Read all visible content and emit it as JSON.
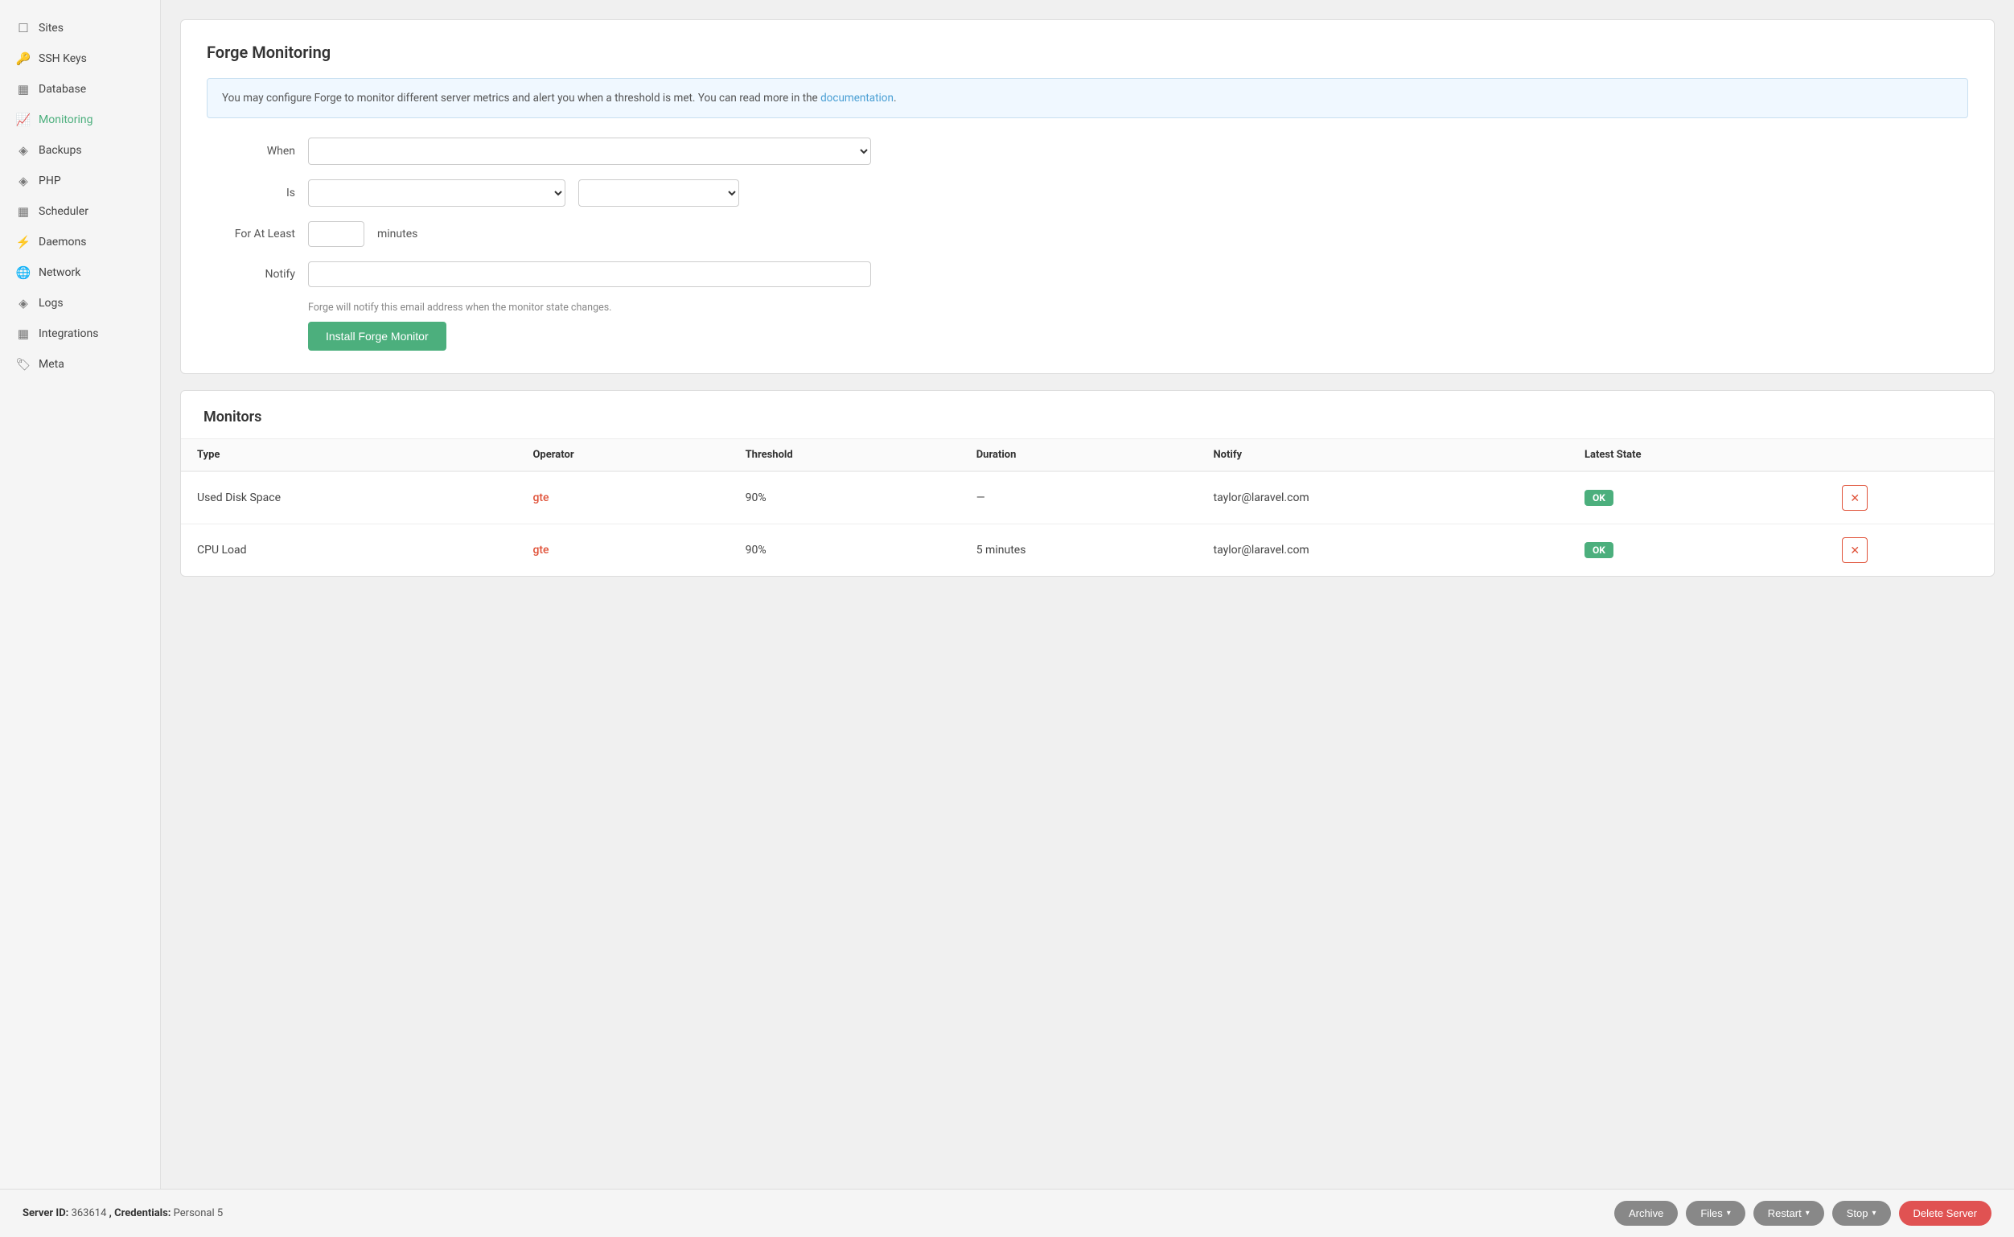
{
  "sidebar": {
    "items": [
      {
        "id": "sites",
        "label": "Sites",
        "icon": "☐",
        "active": false
      },
      {
        "id": "ssh-keys",
        "label": "SSH Keys",
        "icon": "🔑",
        "active": false
      },
      {
        "id": "database",
        "label": "Database",
        "icon": "▦",
        "active": false
      },
      {
        "id": "monitoring",
        "label": "Monitoring",
        "icon": "📈",
        "active": true
      },
      {
        "id": "backups",
        "label": "Backups",
        "icon": "◈",
        "active": false
      },
      {
        "id": "php",
        "label": "PHP",
        "icon": "◈",
        "active": false
      },
      {
        "id": "scheduler",
        "label": "Scheduler",
        "icon": "▦",
        "active": false
      },
      {
        "id": "daemons",
        "label": "Daemons",
        "icon": "⚡",
        "active": false
      },
      {
        "id": "network",
        "label": "Network",
        "icon": "🌐",
        "active": false
      },
      {
        "id": "logs",
        "label": "Logs",
        "icon": "◈",
        "active": false
      },
      {
        "id": "integrations",
        "label": "Integrations",
        "icon": "▦",
        "active": false
      },
      {
        "id": "meta",
        "label": "Meta",
        "icon": "🏷",
        "active": false
      }
    ]
  },
  "forge_monitoring": {
    "title": "Forge Monitoring",
    "info_text": "You may configure Forge to monitor different server metrics and alert you when a threshold is met. You can read more in the ",
    "info_link_text": "documentation",
    "info_text_end": ".",
    "when_label": "When",
    "is_label": "Is",
    "for_at_least_label": "For At Least",
    "minutes_text": "minutes",
    "notify_label": "Notify",
    "notify_hint": "Forge will notify this email address when the monitor state changes.",
    "install_button": "Install Forge Monitor"
  },
  "monitors": {
    "title": "Monitors",
    "columns": [
      "Type",
      "Operator",
      "Threshold",
      "Duration",
      "Notify",
      "Latest State"
    ],
    "rows": [
      {
        "type": "Used Disk Space",
        "operator": "gte",
        "threshold": "90%",
        "duration": "—",
        "notify": "taylor@laravel.com",
        "latest_state": "OK"
      },
      {
        "type": "CPU Load",
        "operator": "gte",
        "threshold": "90%",
        "duration": "5 minutes",
        "notify": "taylor@laravel.com",
        "latest_state": "OK"
      }
    ]
  },
  "footer": {
    "server_id_label": "Server ID:",
    "server_id_value": "363614",
    "credentials_label": "Credentials:",
    "credentials_value": "Personal 5",
    "buttons": [
      {
        "id": "archive",
        "label": "Archive",
        "has_chevron": false
      },
      {
        "id": "files",
        "label": "Files",
        "has_chevron": true
      },
      {
        "id": "restart",
        "label": "Restart",
        "has_chevron": true
      },
      {
        "id": "stop",
        "label": "Stop",
        "has_chevron": true
      },
      {
        "id": "delete-server",
        "label": "Delete Server",
        "has_chevron": false,
        "red": true
      }
    ]
  }
}
